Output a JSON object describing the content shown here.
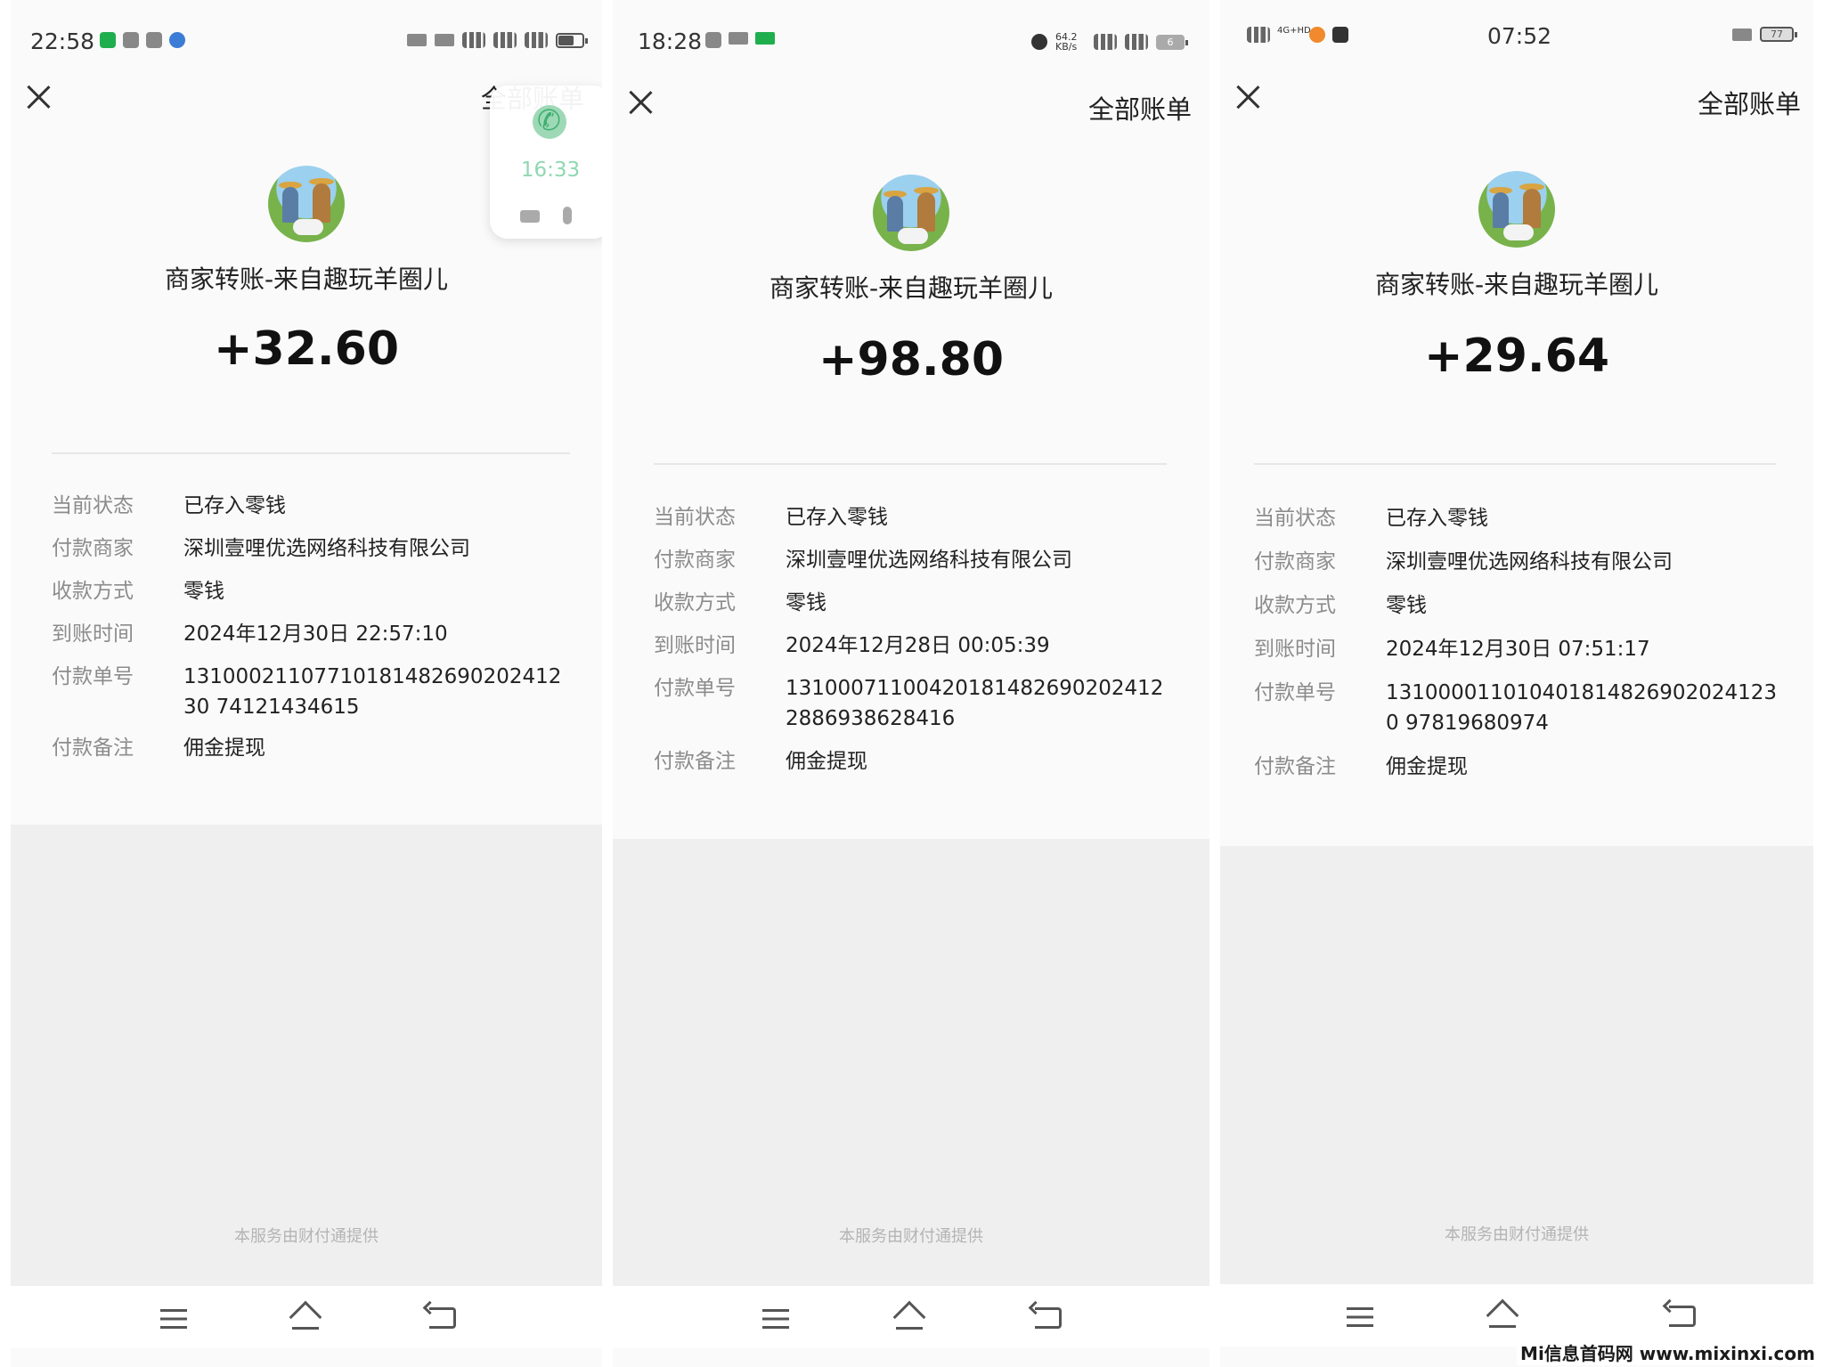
{
  "screens": [
    {
      "status_time": "22:58",
      "status_text": "",
      "nav": {
        "all_bills": "全部账单"
      },
      "merchant_title": "商家转账-来自趣玩羊圈儿",
      "amount": "+32.60",
      "details": [
        {
          "label": "当前状态",
          "value": "已存入零钱"
        },
        {
          "label": "付款商家",
          "value": "深圳壹哩优选网络科技有限公司"
        },
        {
          "label": "收款方式",
          "value": "零钱"
        },
        {
          "label": "到账时间",
          "value": "2024年12月30日 22:57:10"
        },
        {
          "label": "付款单号",
          "value": "1310002110771018148269020241230 74121434615"
        },
        {
          "label": "付款备注",
          "value": "佣金提现"
        }
      ],
      "provider": "本服务由财付通提供",
      "call_overlay": {
        "time": "16:33"
      }
    },
    {
      "status_time": "18:28",
      "status_text": "64.2 KB/s",
      "battery": "6",
      "nav": {
        "all_bills": "全部账单"
      },
      "merchant_title": "商家转账-来自趣玩羊圈儿",
      "amount": "+98.80",
      "details": [
        {
          "label": "当前状态",
          "value": "已存入零钱"
        },
        {
          "label": "付款商家",
          "value": "深圳壹哩优选网络科技有限公司"
        },
        {
          "label": "收款方式",
          "value": "零钱"
        },
        {
          "label": "到账时间",
          "value": "2024年12月28日 00:05:39"
        },
        {
          "label": "付款单号",
          "value": "131000711004201814826902024122886938628416"
        },
        {
          "label": "付款备注",
          "value": "佣金提现"
        }
      ],
      "provider": "本服务由财付通提供"
    },
    {
      "status_time": "07:52",
      "status_text": "4G+HD",
      "battery": "77",
      "nav": {
        "all_bills": "全部账单"
      },
      "merchant_title": "商家转账-来自趣玩羊圈儿",
      "amount": "+29.64",
      "details": [
        {
          "label": "当前状态",
          "value": "已存入零钱"
        },
        {
          "label": "付款商家",
          "value": "深圳壹哩优选网络科技有限公司"
        },
        {
          "label": "收款方式",
          "value": "零钱"
        },
        {
          "label": "到账时间",
          "value": "2024年12月30日 07:51:17"
        },
        {
          "label": "付款单号",
          "value": "1310000110104018148269020241230 97819680974"
        },
        {
          "label": "付款备注",
          "value": "佣金提现"
        }
      ],
      "provider": "本服务由财付通提供"
    }
  ],
  "watermark": "Mi信息首码网 www.mixinxi.com",
  "icons": [
    "close-icon",
    "menu-icon",
    "home-icon",
    "back-icon",
    "phone-icon",
    "video-icon",
    "mic-icon"
  ],
  "colors": {
    "amount": "#111111",
    "label": "#8c8c8c",
    "call_green": "#3fae72",
    "gray_area": "#efefef"
  }
}
